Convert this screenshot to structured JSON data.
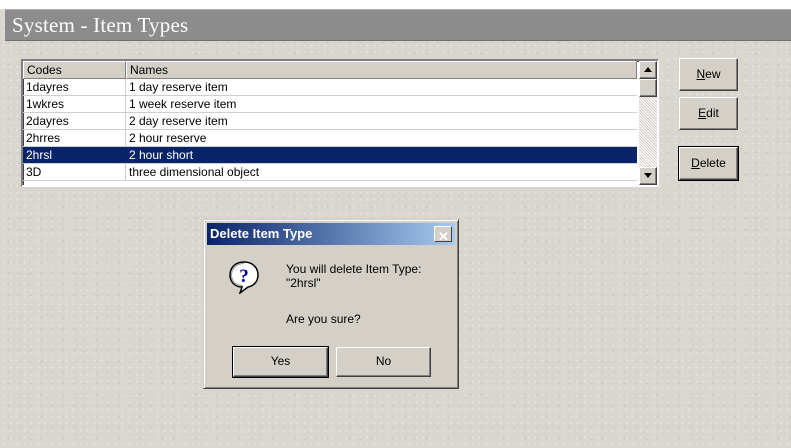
{
  "window": {
    "title": "System - Item Types"
  },
  "list": {
    "columns": [
      "Codes",
      "Names"
    ],
    "rows": [
      {
        "code": "1dayres",
        "name": "1 day reserve item"
      },
      {
        "code": "1wkres",
        "name": "1 week reserve item"
      },
      {
        "code": "2dayres",
        "name": "2 day reserve item"
      },
      {
        "code": "2hrres",
        "name": "2 hour reserve"
      },
      {
        "code": "2hrsl",
        "name": "2 hour short"
      },
      {
        "code": "3D",
        "name": "three dimensional object"
      }
    ],
    "selected_code": "2hrsl"
  },
  "buttons": {
    "new": {
      "label": "New",
      "mnemonic": "N",
      "rest": "ew"
    },
    "edit": {
      "label": "Edit",
      "mnemonic": "E",
      "rest": "dit"
    },
    "delete": {
      "label": "Delete",
      "mnemonic": "D",
      "rest": "elete"
    }
  },
  "dialog": {
    "title": "Delete  Item Type",
    "close_glyph": "✕",
    "message_line1": "You will delete  Item Type:",
    "message_line2": "\"2hrsl\"",
    "confirm": "Are you sure?",
    "yes_label": "Yes",
    "no_label": "No",
    "icon": "question-icon"
  },
  "colors": {
    "title_bar": "#8c8c8c",
    "selection": "#0a246a",
    "dialog_title_start": "#0a246a",
    "dialog_title_end": "#a6caf0"
  }
}
